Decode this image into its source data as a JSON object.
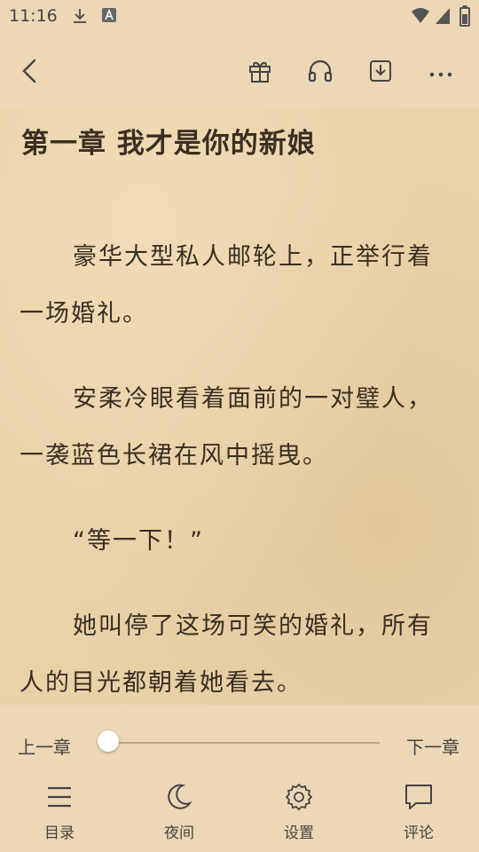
{
  "status_bar": {
    "time": "11:16",
    "icons": [
      "download-icon",
      "app-notification-icon",
      "wifi-icon",
      "signal-icon",
      "battery-icon"
    ]
  },
  "toolbar": {
    "buttons": [
      "back-arrow-icon",
      "gift-icon",
      "headphones-icon",
      "download-chapter-icon",
      "more-icon"
    ]
  },
  "chapter": {
    "title": "第一章 我才是你的新娘",
    "paragraphs": [
      "豪华大型私人邮轮上，正举行着一场婚礼。",
      "安柔冷眼看着面前的一对璧人，一袭蓝色长裙在风中摇曳。",
      "“等一下！”",
      "她叫停了这场可笑的婚礼，所有人的目光都朝着她看去。"
    ]
  },
  "progress": {
    "prev_label": "上一章",
    "next_label": "下一章",
    "value": 0
  },
  "bottom_nav": [
    {
      "label": "目录",
      "icon": "catalog-icon"
    },
    {
      "label": "夜间",
      "icon": "moon-icon"
    },
    {
      "label": "设置",
      "icon": "gear-icon"
    },
    {
      "label": "评论",
      "icon": "comment-icon"
    }
  ],
  "colors": {
    "background": "#ecd8b6",
    "paper": "#e9d1a8",
    "text": "#3a2e22"
  }
}
